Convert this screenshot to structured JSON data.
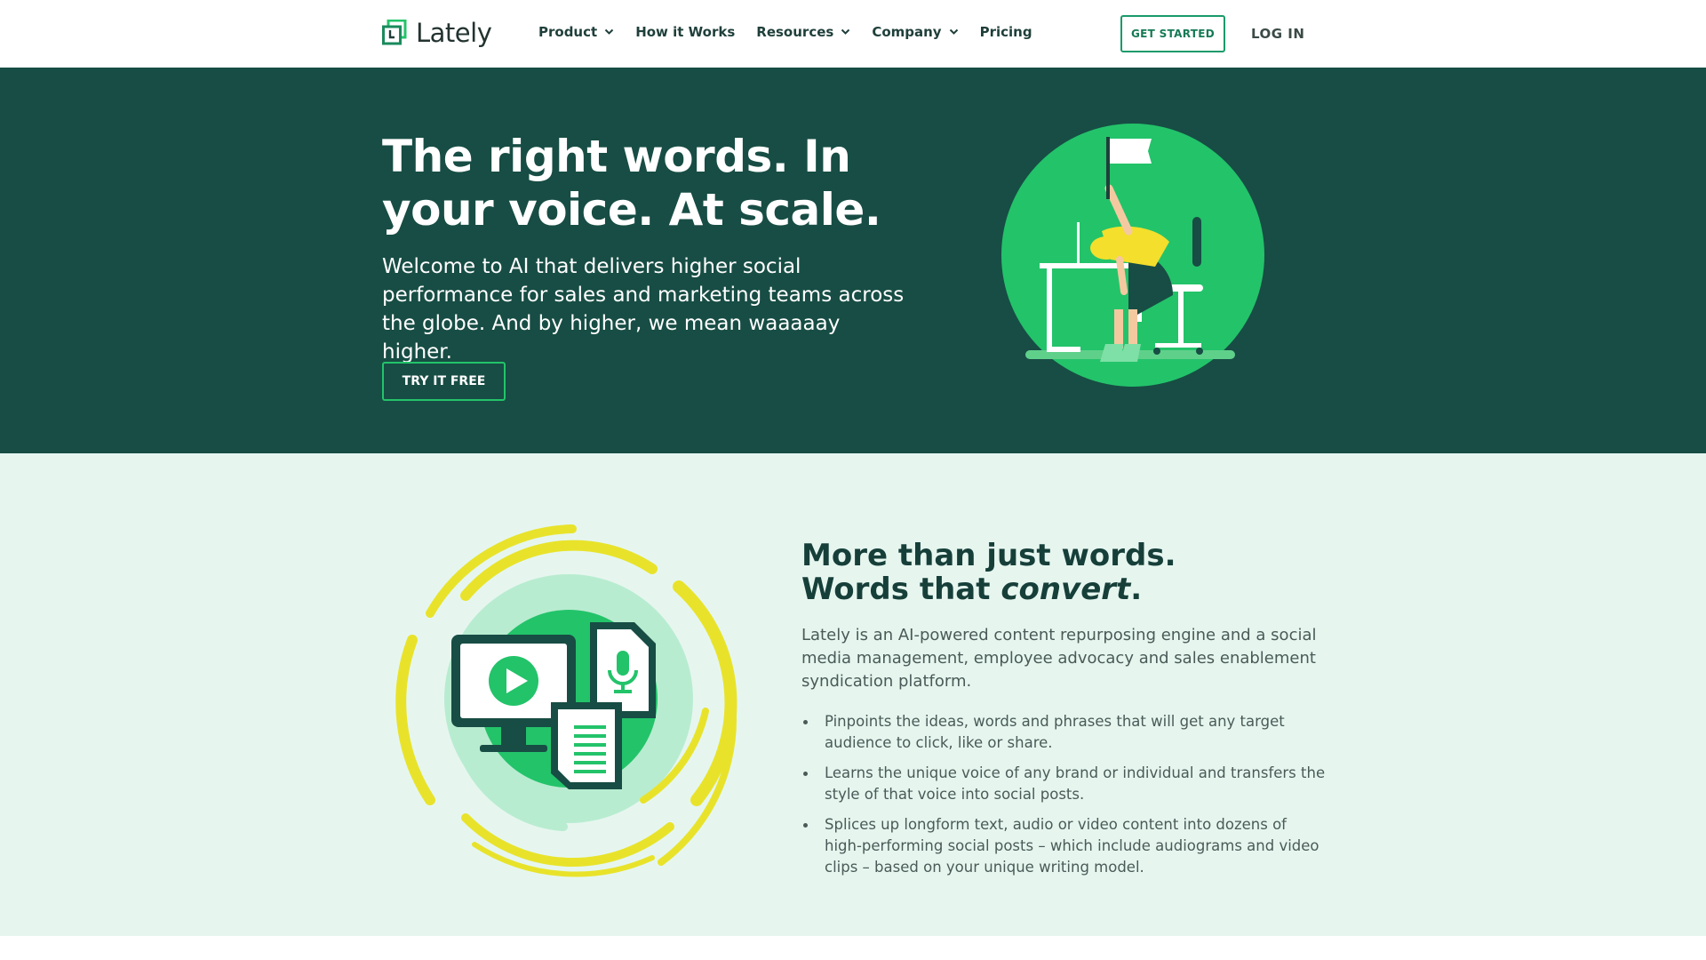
{
  "brand": {
    "name": "Lately",
    "accent": "#23c36a",
    "dark_green": "#174d44",
    "mint_bg": "#e6f6ef"
  },
  "nav": {
    "items": [
      {
        "label": "Product",
        "has_dropdown": true
      },
      {
        "label": "How it Works",
        "has_dropdown": false
      },
      {
        "label": "Resources",
        "has_dropdown": true
      },
      {
        "label": "Company",
        "has_dropdown": true
      },
      {
        "label": "Pricing",
        "has_dropdown": false
      }
    ],
    "get_started": "GET STARTED",
    "login": "LOG IN"
  },
  "hero": {
    "title": "The right words. In your voice. At scale.",
    "subtitle": "Welcome to AI that delivers higher social performance for sales and marketing teams across the globe. And by higher, we mean waaaaay higher.",
    "cta": "TRY IT FREE"
  },
  "feature": {
    "title_part1": "More than just words. Words that ",
    "title_emphasis": "convert",
    "title_end": ".",
    "body": "Lately is an AI-powered content repurposing engine and a social media management, employee advocacy and sales enablement syndication platform.",
    "bullets": [
      "Pinpoints the ideas, words and phrases that will get any target audience to click, like or share.",
      "Learns the unique voice of any brand or individual and transfers the style of that voice into social posts.",
      "Splices up longform text, audio or video content into dozens of high-performing social posts – which include audiograms and video clips – based on your unique writing model."
    ]
  },
  "icons": [
    "lately-logo-icon",
    "chevron-down-icon",
    "woman-at-desk-illustration",
    "play-icon",
    "microphone-icon",
    "document-icon",
    "monitor-icon"
  ]
}
